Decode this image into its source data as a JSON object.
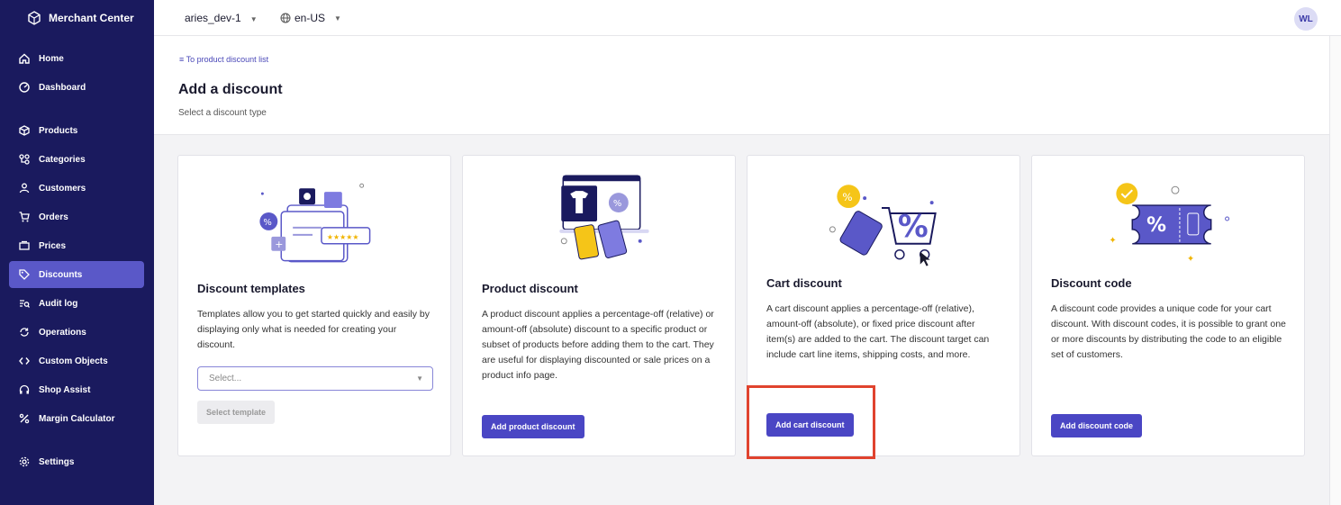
{
  "app": {
    "name": "Merchant Center"
  },
  "sidebar": {
    "items": [
      {
        "label": "Home",
        "icon": "home-icon"
      },
      {
        "label": "Dashboard",
        "icon": "dashboard-icon"
      },
      {
        "label": "Products",
        "icon": "box-icon"
      },
      {
        "label": "Categories",
        "icon": "categories-icon"
      },
      {
        "label": "Customers",
        "icon": "person-icon"
      },
      {
        "label": "Orders",
        "icon": "cart-icon"
      },
      {
        "label": "Prices",
        "icon": "prices-icon"
      },
      {
        "label": "Discounts",
        "icon": "discount-icon",
        "active": true
      },
      {
        "label": "Audit log",
        "icon": "audit-icon"
      },
      {
        "label": "Operations",
        "icon": "operations-icon"
      },
      {
        "label": "Custom Objects",
        "icon": "code-icon"
      },
      {
        "label": "Shop Assist",
        "icon": "headset-icon"
      },
      {
        "label": "Margin Calculator",
        "icon": "percent-icon"
      },
      {
        "label": "Settings",
        "icon": "gear-icon"
      }
    ]
  },
  "topbar": {
    "project": "aries_dev-1",
    "locale": "en-US",
    "avatar": "WL"
  },
  "header": {
    "back_link": "To product discount list",
    "title": "Add a discount",
    "subtitle": "Select a discount type"
  },
  "cards": [
    {
      "title": "Discount templates",
      "description": "Templates allow you to get started quickly and easily by displaying only what is needed for creating your discount.",
      "select_placeholder": "Select...",
      "button": "Select template"
    },
    {
      "title": "Product discount",
      "description": "A product discount applies a percentage-off (relative) or amount-off (absolute) discount to a specific product or subset of products before adding them to the cart. They are useful for displaying discounted or sale prices on a product info page.",
      "button": "Add product discount"
    },
    {
      "title": "Cart discount",
      "description": "A cart discount applies a percentage-off (relative), amount-off (absolute), or fixed price discount after item(s) are added to the cart. The discount target can include cart line items, shipping costs, and more.",
      "button": "Add cart discount"
    },
    {
      "title": "Discount code",
      "description": "A discount code provides a unique code for your cart discount. With discount codes, it is possible to grant one or more discounts by distributing the code to an eligible set of customers.",
      "button": "Add discount code"
    }
  ],
  "colors": {
    "sidebar": "#1a1a5e",
    "accent": "#4a46c4",
    "highlight": "#e0432e"
  }
}
